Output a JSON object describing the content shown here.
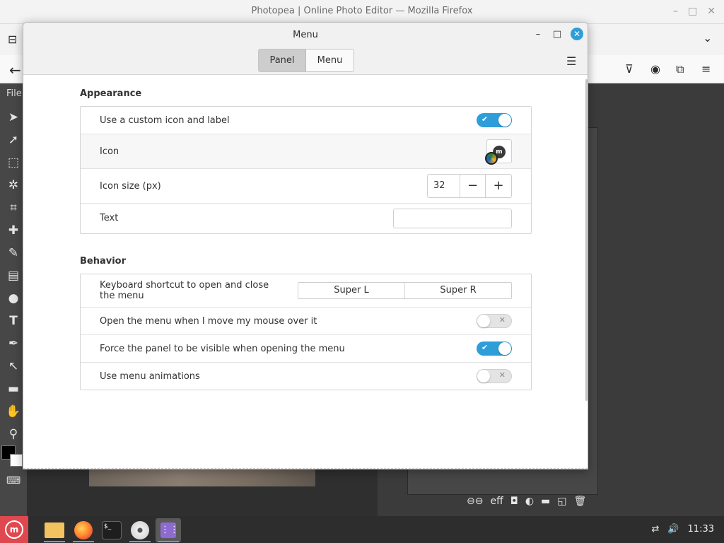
{
  "firefox": {
    "title": "Photopea | Online Photo Editor — Mozilla Firefox",
    "window_buttons": [
      "–",
      "□",
      "✕"
    ]
  },
  "photopea": {
    "menu_file": "File",
    "tools": [
      "move-tool-icon",
      "select-tool-icon",
      "marquee-tool-icon",
      "magic-wand-icon",
      "crop-tool-icon",
      "healing-tool-icon",
      "brush-tool-icon",
      "gradient-tool-icon",
      "blur-tool-icon",
      "type-tool-icon",
      "pen-tool-icon",
      "path-select-icon",
      "shape-tool-icon",
      "hand-tool-icon",
      "zoom-tool-icon"
    ],
    "layer_actions": [
      "⊖⊖",
      "eff",
      "◘",
      "◐",
      "▬",
      "◱",
      "🗑"
    ]
  },
  "dialog": {
    "title": "Menu",
    "tabs": [
      {
        "label": "Panel",
        "active": true
      },
      {
        "label": "Menu",
        "active": false
      }
    ],
    "appearance": {
      "title": "Appearance",
      "custom_icon_label": "Use a custom icon and label",
      "custom_icon_enabled": true,
      "icon_label": "Icon",
      "icon_size_label": "Icon size (px)",
      "icon_size_value": "32",
      "text_label": "Text",
      "text_value": ""
    },
    "behavior": {
      "title": "Behavior",
      "shortcut_label": "Keyboard shortcut to open and close the menu",
      "shortcuts": [
        "Super L",
        "Super R"
      ],
      "hover_label": "Open the menu when I move my mouse over it",
      "hover_enabled": false,
      "force_panel_label": "Force the panel to be visible when opening the menu",
      "force_panel_enabled": true,
      "animations_label": "Use menu animations",
      "animations_enabled": false
    }
  },
  "taskbar": {
    "clock": "11:33",
    "apps": [
      "files-icon",
      "firefox-icon",
      "terminal-icon",
      "disc-icon",
      "app-grid-icon"
    ]
  },
  "colors": {
    "accent": "#2e9ed9",
    "mint_red": "#e0484f"
  }
}
